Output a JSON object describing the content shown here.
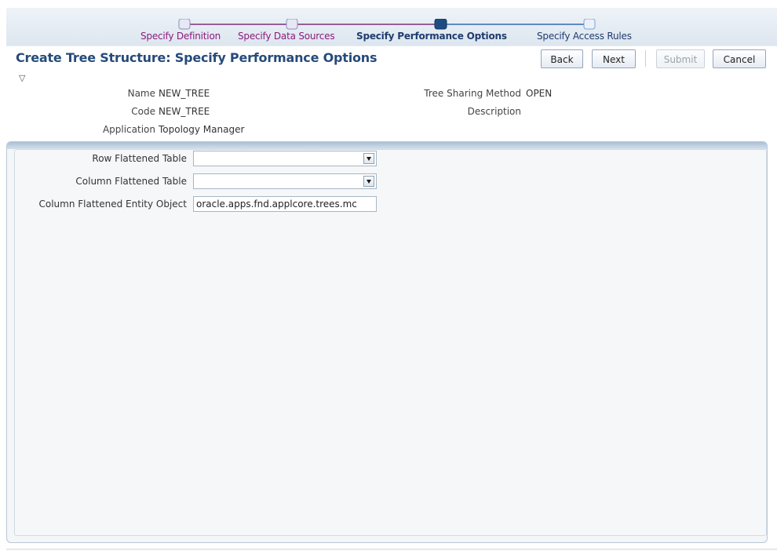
{
  "train": {
    "steps": [
      {
        "label": "Specify Definition",
        "state": "visited"
      },
      {
        "label": "Specify Data Sources",
        "state": "visited"
      },
      {
        "label": "Specify Performance Options",
        "state": "current"
      },
      {
        "label": "Specify Access Rules",
        "state": "future"
      }
    ],
    "colors": {
      "visited": "#8a1b7e",
      "current": "#1f3c6e",
      "future": "#1f3c6e"
    }
  },
  "page": {
    "title": "Create Tree Structure: Specify Performance Options",
    "collapse_glyph": "▽"
  },
  "buttons": {
    "back": {
      "label": "Back"
    },
    "next": {
      "label": "Next"
    },
    "submit": {
      "label": "Submit",
      "enabled": false
    },
    "cancel": {
      "label": "Cancel"
    }
  },
  "info": {
    "name_label": "Name",
    "name_value": "NEW_TREE",
    "code_label": "Code",
    "code_value": "NEW_TREE",
    "application_label": "Application",
    "application_value": "Topology Manager",
    "sharing_label": "Tree Sharing Method",
    "sharing_value": "OPEN",
    "description_label": "Description",
    "description_value": ""
  },
  "form": {
    "row_flattened_table": {
      "label": "Row Flattened Table",
      "value": ""
    },
    "column_flattened_table": {
      "label": "Column Flattened Table",
      "value": ""
    },
    "column_flattened_entity_object": {
      "label": "Column Flattened Entity Object",
      "value": "oracle.apps.fnd.applcore.trees.mc"
    }
  }
}
